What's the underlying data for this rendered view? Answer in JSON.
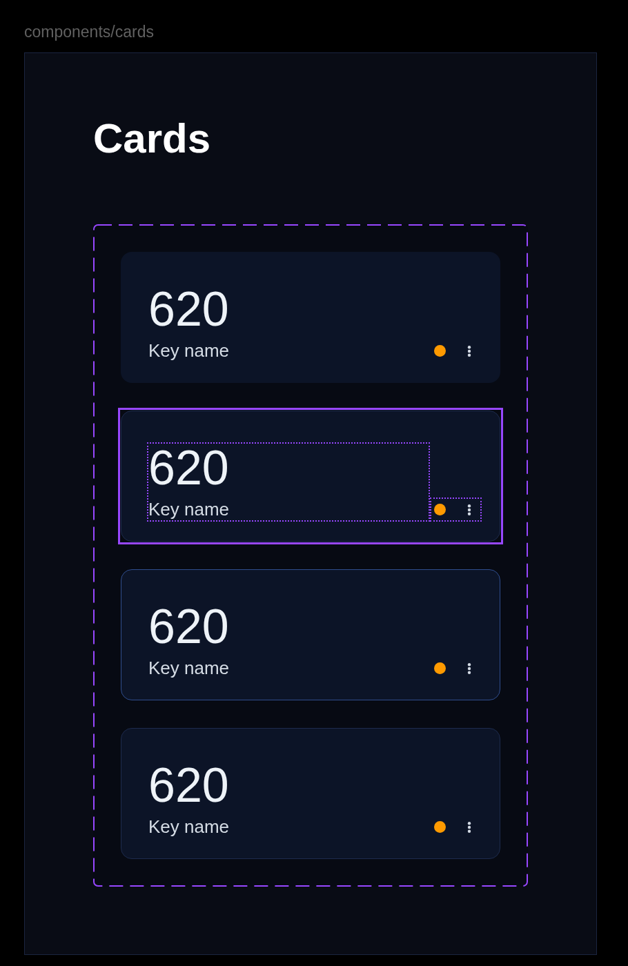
{
  "canvas_label": "components/cards",
  "frame": {
    "title": "Cards",
    "cards": [
      {
        "value": "620",
        "label": "Key name",
        "color": "#ff9a00",
        "kind": "plain",
        "selected": false
      },
      {
        "value": "620",
        "label": "Key name",
        "color": "#ff9a00",
        "kind": "outlined",
        "selected": true
      },
      {
        "value": "620",
        "label": "Key name",
        "color": "#ff9a00",
        "kind": "highlighted",
        "selected": false
      },
      {
        "value": "620",
        "label": "Key name",
        "color": "#ff9a00",
        "kind": "outlined",
        "selected": false
      }
    ]
  }
}
